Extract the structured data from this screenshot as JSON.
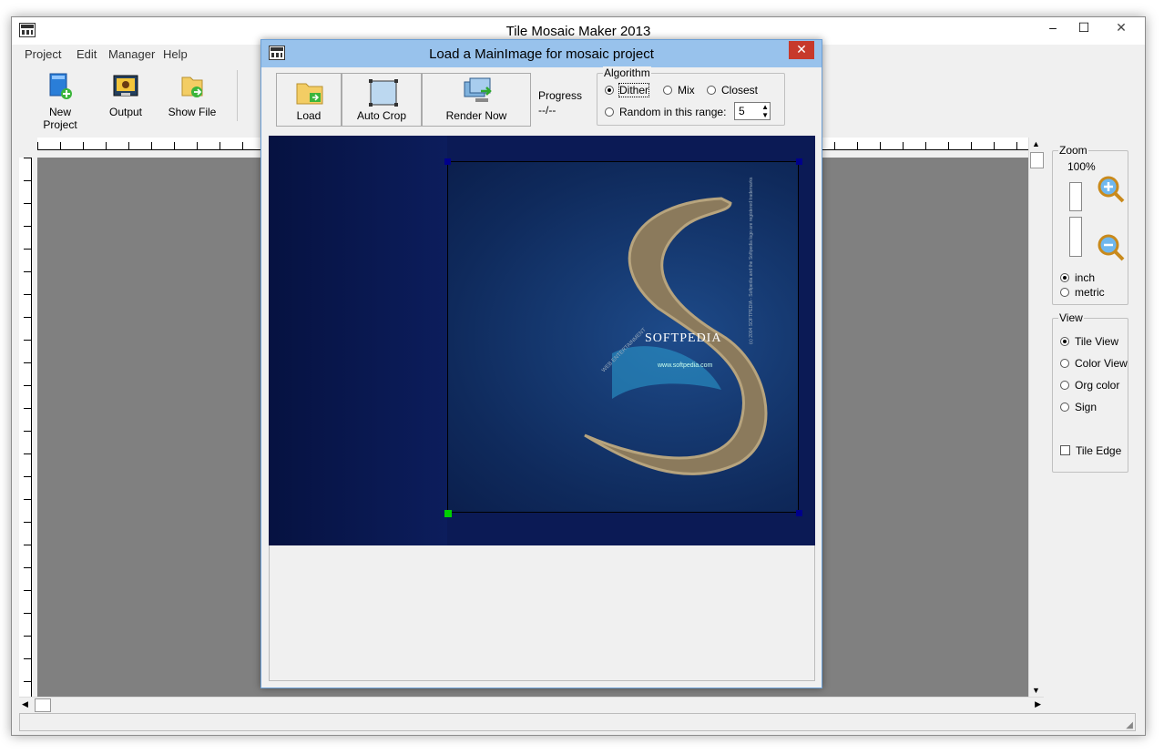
{
  "main_window": {
    "title": "Tile Mosaic Maker 2013",
    "controls": {
      "minimize": "–",
      "maximize": "☐",
      "close": "✕"
    }
  },
  "menu": [
    "Project",
    "Edit",
    "Manager",
    "Help"
  ],
  "toolbar": {
    "new_project": "New Project",
    "output": "Output",
    "show_file": "Show File"
  },
  "zoom_panel": {
    "title": "Zoom",
    "level": "100%",
    "units": [
      {
        "label": "inch",
        "selected": true
      },
      {
        "label": "metric",
        "selected": false
      }
    ]
  },
  "view_panel": {
    "title": "View",
    "options": [
      {
        "label": "Tile View",
        "selected": true
      },
      {
        "label": "Color View",
        "selected": false
      },
      {
        "label": "Org color",
        "selected": false
      },
      {
        "label": "Sign",
        "selected": false
      }
    ],
    "tile_edge": {
      "label": "Tile Edge",
      "checked": false
    }
  },
  "dialog": {
    "title": "Load a MainImage for mosaic project",
    "close": "✕",
    "buttons": {
      "load": "Load",
      "auto_crop": "Auto Crop",
      "render_now": "Render Now"
    },
    "progress": {
      "label": "Progress",
      "value": "--/--"
    },
    "algorithm": {
      "title": "Algorithm",
      "options": [
        {
          "label": "Dither",
          "selected": true
        },
        {
          "label": "Mix",
          "selected": false
        },
        {
          "label": "Closest",
          "selected": false
        },
        {
          "label": "Random in this range:",
          "selected": false
        }
      ],
      "range_value": "5"
    },
    "image": {
      "brand": "SOFTPEDIA",
      "url": "www.softpedia.com",
      "tagline": "WEB ENTERTAINMENT",
      "vertical_note": "(c) 2004 SOFTPEDIA - Softpedia and the Softpedia logo are registered trademarks"
    }
  },
  "colors": {
    "dialog_title_bar": "#98c2ec",
    "close_red": "#c7392b",
    "canvas_gray": "#808080",
    "image_navy": "#0b1a55"
  }
}
